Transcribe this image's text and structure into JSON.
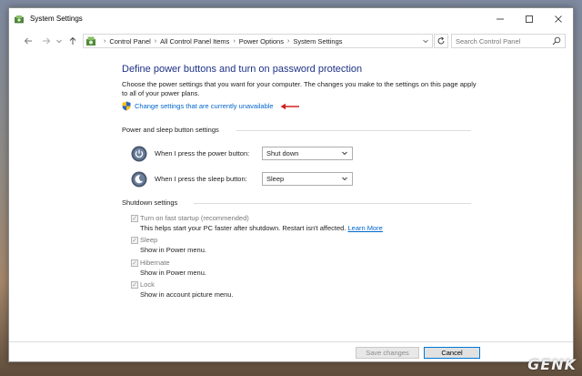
{
  "window": {
    "title": "System Settings",
    "icon": "power-options-icon"
  },
  "addressbar": {
    "crumbs": [
      "Control Panel",
      "All Control Panel Items",
      "Power Options",
      "System Settings"
    ]
  },
  "search": {
    "placeholder": "Search Control Panel"
  },
  "main": {
    "heading": "Define power buttons and turn on password protection",
    "description": "Choose the power settings that you want for your computer. The changes you make to the settings on this page apply to all of your power plans.",
    "change_link": "Change settings that are currently unavailable"
  },
  "power_section": {
    "title": "Power and sleep button settings",
    "rows": [
      {
        "label": "When I press the power button:",
        "value": "Shut down"
      },
      {
        "label": "When I press the sleep button:",
        "value": "Sleep"
      }
    ]
  },
  "shutdown_section": {
    "title": "Shutdown settings",
    "options": [
      {
        "label": "Turn on fast startup (recommended)",
        "desc": "This helps start your PC faster after shutdown. Restart isn't affected.",
        "link": "Learn More",
        "checked": true
      },
      {
        "label": "Sleep",
        "desc": "Show in Power menu.",
        "checked": true
      },
      {
        "label": "Hibernate",
        "desc": "Show in Power menu.",
        "checked": true
      },
      {
        "label": "Lock",
        "desc": "Show in account picture menu.",
        "checked": true
      }
    ]
  },
  "footer": {
    "save_label": "Save changes",
    "cancel_label": "Cancel"
  },
  "watermark": "GENK",
  "colors": {
    "heading": "#1e3287",
    "link": "#0066cc",
    "arrow": "#d42020",
    "shield_blue": "#2a63c4",
    "shield_yellow": "#f2c01e"
  }
}
